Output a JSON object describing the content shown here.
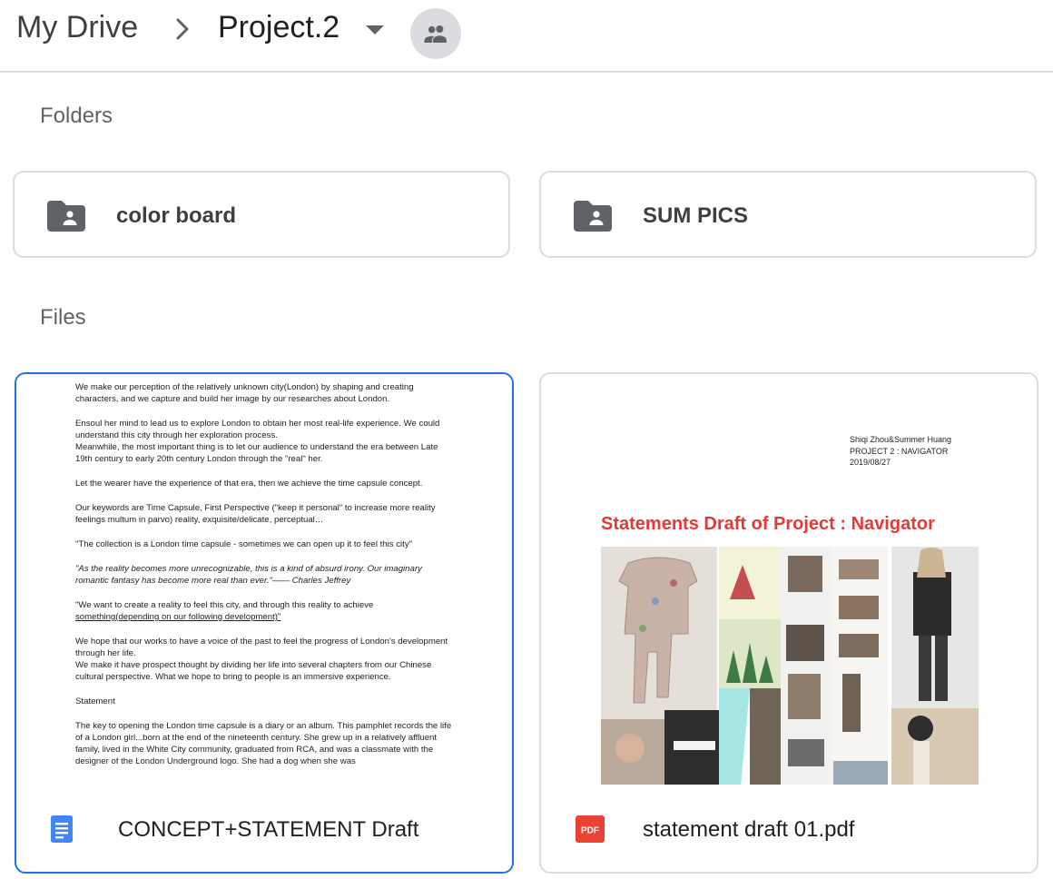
{
  "breadcrumb": {
    "root": "My Drive",
    "current": "Project.2"
  },
  "icons": {
    "separator": "chevron-right-icon",
    "dropdown": "caret-down-icon",
    "shared": "people-icon",
    "folder": "shared-folder-icon",
    "doc": "google-docs-icon",
    "pdf": "pdf-icon"
  },
  "sections": {
    "folders": "Folders",
    "files": "Files"
  },
  "folders": [
    {
      "name": "color board"
    },
    {
      "name": "SUM PICS"
    }
  ],
  "files": [
    {
      "name": "CONCEPT+STATEMENT Draft",
      "type_badge": "",
      "preview": {
        "p1": "We make our perception of the relatively unknown city(London) by shaping and creating characters, and we capture and build her image by our researches about London.",
        "p2a": "Ensoul her mind to lead us to explore London to obtain her most real-life experience. We could understand this city through her exploration process.",
        "p2b": "Meanwhile, the most important thing is to let our audience to understand the era between Late 19th century to early 20th century London through the \"real\" her.",
        "p3": "Let the wearer have the experience of that era, then we achieve the time capsule concept.",
        "p4": "Our keywords are Time Capsule, First Perspective (\"keep it personal\" to increase more reality feelings multum in parvo) reality, exquisite/delicate, perceptual…",
        "p5": "\"The collection is a London time capsule - sometimes we can open up it to feel this city\"",
        "p6": "\"As the reality becomes more unrecognizable, this is a kind of absurd irony. Our imaginary romantic fantasy has become more real than ever.\"—— Charles Jeffrey",
        "p7a": "\"We want to create a reality to feel this city, and through this reality to achieve ",
        "p7b": "something(depending on our following development)\"",
        "p8a": "We hope that our works to have a voice of the past to feel the progress of London's development through her life.",
        "p8b": "We make it have prospect thought by dividing  her life into several chapters from our Chinese cultural perspective. What we hope to bring to people is an immersive experience.",
        "p9": "Statement",
        "p10": "The key to opening the London time capsule is a diary or an album. This pamphlet records the life of a London girl...born at the end of the nineteenth century. She grew up in a relatively affluent family, lived in the White City community, graduated from RCA, and was a classmate with the designer of the London Underground logo. She had a dog when she was"
      }
    },
    {
      "name": "statement draft 01.pdf",
      "type_badge": "PDF",
      "preview": {
        "author": "Shiqi Zhou&Summer Huang",
        "project": "PROJECT 2 : NAVIGATOR",
        "date": "2019/08/27",
        "title": "Statements Draft of Project : Navigator"
      }
    }
  ],
  "colors": {
    "border": "#dadce0",
    "selected_border": "#1a73e8",
    "doc_icon": "#4285f4",
    "pdf_icon": "#ea4335",
    "pdf_title": "#e53935",
    "icon_gray": "#5f6368"
  }
}
